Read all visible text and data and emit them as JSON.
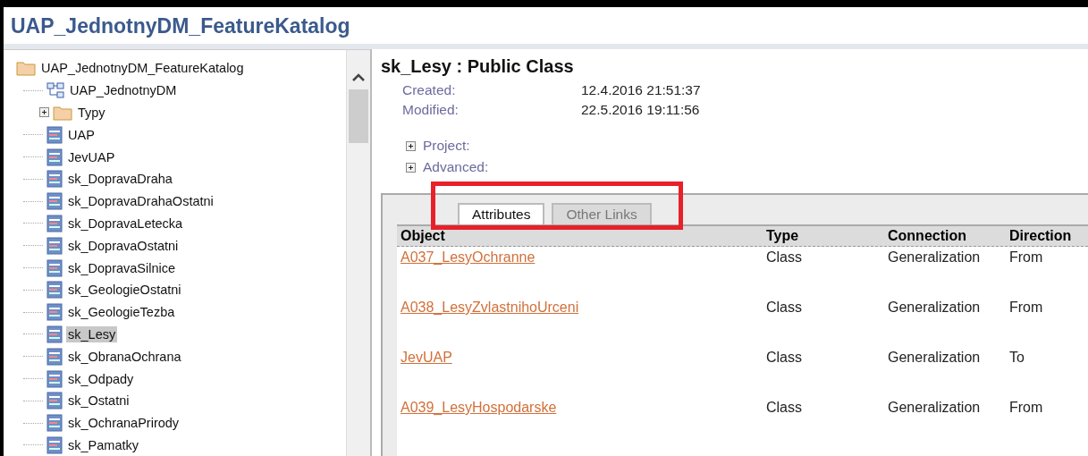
{
  "window": {
    "title": "UAP_JednotnyDM_FeatureKatalog"
  },
  "tree": {
    "label": "UAP_JednotnyDM_FeatureKatalog",
    "kind": "folder",
    "selected": false,
    "children": [
      {
        "label": "UAP_JednotnyDM",
        "kind": "diagram",
        "selected": false
      },
      {
        "label": "Typy",
        "kind": "folder",
        "selected": false,
        "expanded": false
      },
      {
        "label": "UAP",
        "kind": "class",
        "selected": false
      },
      {
        "label": "JevUAP",
        "kind": "class",
        "selected": false
      },
      {
        "label": "sk_DopravaDraha",
        "kind": "class",
        "selected": false
      },
      {
        "label": "sk_DopravaDrahaOstatni",
        "kind": "class",
        "selected": false
      },
      {
        "label": "sk_DopravaLetecka",
        "kind": "class",
        "selected": false
      },
      {
        "label": "sk_DopravaOstatni",
        "kind": "class",
        "selected": false
      },
      {
        "label": "sk_DopravaSilnice",
        "kind": "class",
        "selected": false
      },
      {
        "label": "sk_GeologieOstatni",
        "kind": "class",
        "selected": false
      },
      {
        "label": "sk_GeologieTezba",
        "kind": "class",
        "selected": false
      },
      {
        "label": "sk_Lesy",
        "kind": "class",
        "selected": true
      },
      {
        "label": "sk_ObranaOchrana",
        "kind": "class",
        "selected": false
      },
      {
        "label": "sk_Odpady",
        "kind": "class",
        "selected": false
      },
      {
        "label": "sk_Ostatni",
        "kind": "class",
        "selected": false
      },
      {
        "label": "sk_OchranaPrirody",
        "kind": "class",
        "selected": false
      },
      {
        "label": "sk_Pamatky",
        "kind": "class",
        "selected": false
      }
    ]
  },
  "detail": {
    "heading": "sk_Lesy : Public Class",
    "properties": [
      {
        "label": "Created:",
        "value": "12.4.2016 21:51:37"
      },
      {
        "label": "Modified:",
        "value": "22.5.2016 19:11:56"
      }
    ],
    "sections": [
      {
        "label": "Project:",
        "expanded": false
      },
      {
        "label": "Advanced:",
        "expanded": false
      }
    ],
    "tabs": [
      {
        "label": "Attributes",
        "selected": true
      },
      {
        "label": "Other Links",
        "selected": false
      }
    ],
    "table": {
      "columns": [
        "Object",
        "Type",
        "Connection",
        "Direction"
      ],
      "rows": [
        [
          "A037_LesyOchranne",
          "Class",
          "Generalization",
          "From"
        ],
        [
          "A038_LesyZvlastnihoUrceni",
          "Class",
          "Generalization",
          "From"
        ],
        [
          "JevUAP",
          "Class",
          "Generalization",
          "To"
        ],
        [
          "A039_LesyHospodarske",
          "Class",
          "Generalization",
          "From"
        ]
      ]
    }
  }
}
